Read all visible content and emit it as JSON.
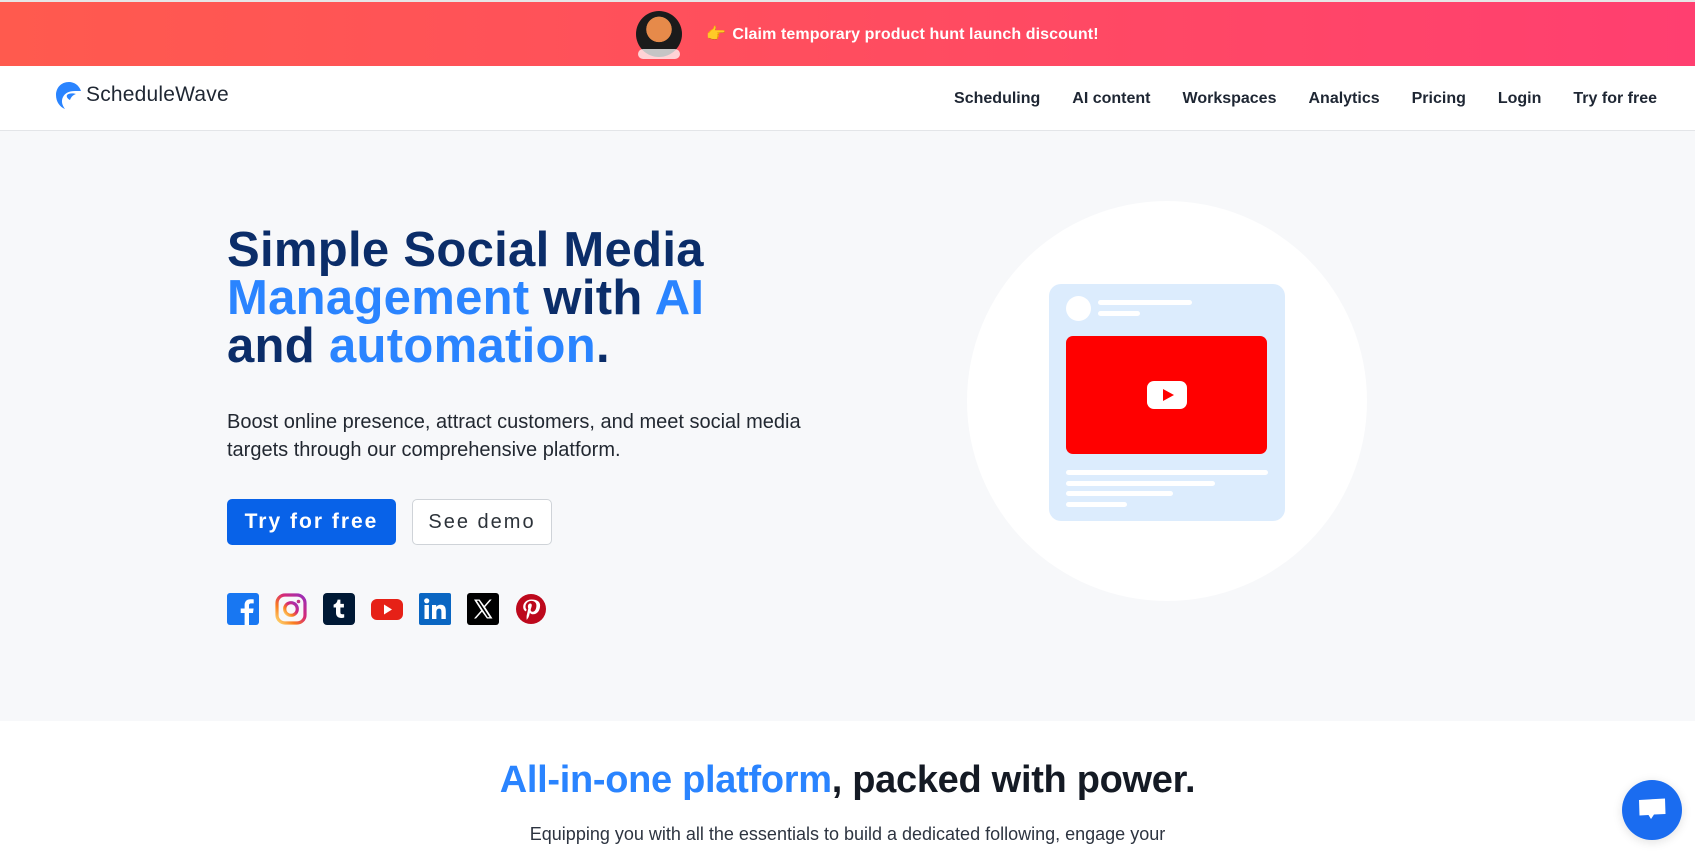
{
  "banner": {
    "badge_icon": "product-hunt-cat-badge",
    "pointer_emoji": "👉",
    "text": "Claim temporary product hunt launch discount!",
    "gradient": [
      "#ff5a4e",
      "#ff3f70"
    ]
  },
  "nav": {
    "logo_text": "ScheduleWave",
    "brand_color": "#2a84ff",
    "links": [
      {
        "label": "Scheduling"
      },
      {
        "label": "AI content"
      },
      {
        "label": "Workspaces"
      },
      {
        "label": "Analytics"
      },
      {
        "label": "Pricing"
      },
      {
        "label": "Login"
      },
      {
        "label": "Try for free"
      }
    ]
  },
  "hero": {
    "title": {
      "line1": "Simple Social Media",
      "accent1": "Management",
      "mid": " with ",
      "accent2": "AI",
      "line3_start": "and ",
      "accent3": "automation",
      "end": "."
    },
    "subtitle": "Boost online presence, attract customers, and meet social media targets through our comprehensive platform.",
    "primary_button": "Try for free",
    "secondary_button": "See demo",
    "socials": [
      "facebook",
      "instagram",
      "tumblr",
      "youtube",
      "linkedin",
      "x",
      "pinterest"
    ],
    "colors": {
      "title": "#0b2d69",
      "accent": "#2a84ff",
      "primary_button": "#0862e8"
    }
  },
  "illustration": {
    "type": "youtube-post-card",
    "video_color": "#ff0000",
    "card_color": "#dcecfd"
  },
  "section2": {
    "title_accent": "All-in-one platform",
    "title_rest": ", packed with power.",
    "subtitle_line1": "Equipping you with all the essentials to build a dedicated following, engage your"
  },
  "chat": {
    "icon": "chat-bubble-icon",
    "color": "#1a6cf0"
  }
}
